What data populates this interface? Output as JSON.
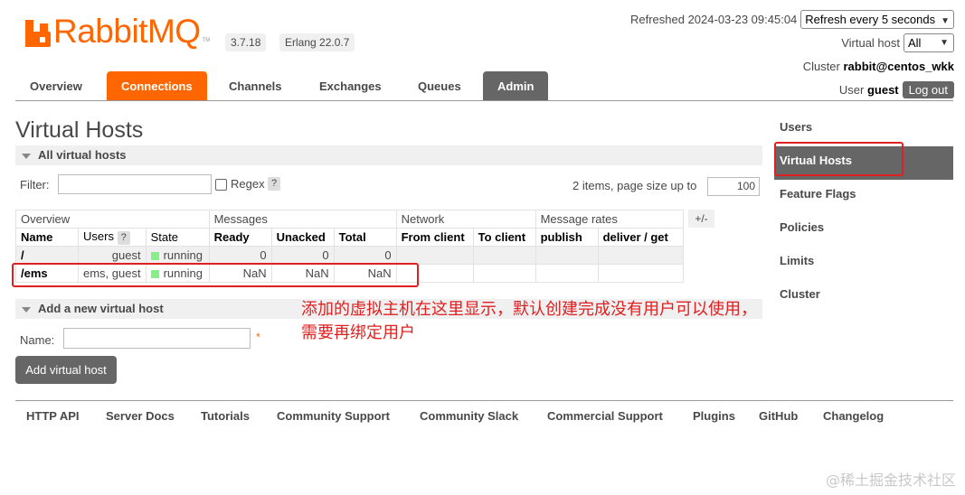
{
  "header": {
    "logo_text": "RabbitMQ",
    "logo_tm": "TM",
    "version": "3.7.18",
    "erlang": "Erlang 22.0.7",
    "refreshed": "Refreshed 2024-03-23 09:45:04",
    "refresh_select": "Refresh every 5 seconds",
    "vhost_label": "Virtual host",
    "vhost_value": "All",
    "cluster_label": "Cluster",
    "cluster_value": "rabbit@centos_wkk",
    "user_label": "User",
    "user_value": "guest",
    "logout": "Log out"
  },
  "tabs": [
    "Overview",
    "Connections",
    "Channels",
    "Exchanges",
    "Queues",
    "Admin"
  ],
  "sidebar": [
    "Users",
    "Virtual Hosts",
    "Feature Flags",
    "Policies",
    "Limits",
    "Cluster"
  ],
  "main": {
    "title": "Virtual Hosts",
    "all_section": "All virtual hosts",
    "filter_label": "Filter:",
    "filter_value": "",
    "regex_label": "Regex",
    "help": "?",
    "items_text": "2 items, page size up to",
    "page_size": "100",
    "plus_minus": "+/-",
    "add_section": "Add a new virtual host",
    "name_label": "Name:",
    "name_value": "",
    "required_mark": "*",
    "add_button": "Add virtual host"
  },
  "table": {
    "groups": [
      "Overview",
      "Messages",
      "Network",
      "Message rates"
    ],
    "columns": [
      "Name",
      "Users",
      "State",
      "Ready",
      "Unacked",
      "Total",
      "From client",
      "To client",
      "publish",
      "deliver / get"
    ],
    "rows": [
      {
        "name": "/",
        "users": "guest",
        "state": "running",
        "ready": "0",
        "unacked": "0",
        "total": "0",
        "from_client": "",
        "to_client": "",
        "publish": "",
        "deliver": ""
      },
      {
        "name": "/ems",
        "users": "ems, guest",
        "state": "running",
        "ready": "NaN",
        "unacked": "NaN",
        "total": "NaN",
        "from_client": "",
        "to_client": "",
        "publish": "",
        "deliver": ""
      }
    ]
  },
  "annotation": {
    "line1": "添加的虚拟主机在这里显示，默认创建完成没有用户可以使用，",
    "line2": "需要再绑定用户",
    "color": "#e02020"
  },
  "footer": [
    "HTTP API",
    "Server Docs",
    "Tutorials",
    "Community Support",
    "Community Slack",
    "Commercial Support",
    "Plugins",
    "GitHub",
    "Changelog"
  ],
  "watermark": "@稀土掘金技术社区",
  "colors": {
    "accent": "#ff6600",
    "dark_tab": "#666666",
    "running": "#88ee88"
  }
}
